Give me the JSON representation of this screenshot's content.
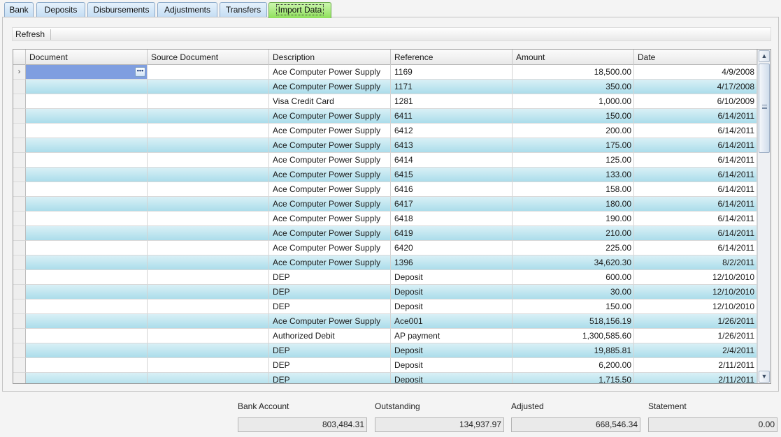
{
  "tabs": [
    {
      "label": "Bank",
      "active": false
    },
    {
      "label": "Deposits",
      "active": false
    },
    {
      "label": "Disbursements",
      "active": false
    },
    {
      "label": "Adjustments",
      "active": false
    },
    {
      "label": "Transfers",
      "active": false
    },
    {
      "label": "Import Data",
      "active": true
    }
  ],
  "toolbar": {
    "refresh_label": "Refresh"
  },
  "grid": {
    "columns": [
      "Document",
      "Source Document",
      "Description",
      "Reference",
      "Amount",
      "Date"
    ],
    "rows": [
      {
        "description": "Ace Computer Power  Supply",
        "reference": "1169",
        "amount": "18,500.00",
        "date": "4/9/2008"
      },
      {
        "description": "Ace Computer Power  Supply",
        "reference": "1171",
        "amount": "350.00",
        "date": "4/17/2008"
      },
      {
        "description": "Visa Credit Card",
        "reference": "1281",
        "amount": "1,000.00",
        "date": "6/10/2009"
      },
      {
        "description": "Ace Computer Power  Supply",
        "reference": "6411",
        "amount": "150.00",
        "date": "6/14/2011"
      },
      {
        "description": "Ace Computer Power  Supply",
        "reference": "6412",
        "amount": "200.00",
        "date": "6/14/2011"
      },
      {
        "description": "Ace Computer Power  Supply",
        "reference": "6413",
        "amount": "175.00",
        "date": "6/14/2011"
      },
      {
        "description": "Ace Computer Power  Supply",
        "reference": "6414",
        "amount": "125.00",
        "date": "6/14/2011"
      },
      {
        "description": "Ace Computer Power  Supply",
        "reference": "6415",
        "amount": "133.00",
        "date": "6/14/2011"
      },
      {
        "description": "Ace Computer Power  Supply",
        "reference": "6416",
        "amount": "158.00",
        "date": "6/14/2011"
      },
      {
        "description": "Ace Computer Power  Supply",
        "reference": "6417",
        "amount": "180.00",
        "date": "6/14/2011"
      },
      {
        "description": "Ace Computer Power  Supply",
        "reference": "6418",
        "amount": "190.00",
        "date": "6/14/2011"
      },
      {
        "description": "Ace Computer Power  Supply",
        "reference": "6419",
        "amount": "210.00",
        "date": "6/14/2011"
      },
      {
        "description": "Ace Computer Power  Supply",
        "reference": "6420",
        "amount": "225.00",
        "date": "6/14/2011"
      },
      {
        "description": "Ace Computer Power  Supply",
        "reference": "1396",
        "amount": "34,620.30",
        "date": "8/2/2011"
      },
      {
        "description": "DEP",
        "reference": "Deposit",
        "amount": "600.00",
        "date": "12/10/2010"
      },
      {
        "description": "DEP",
        "reference": "Deposit",
        "amount": "30.00",
        "date": "12/10/2010"
      },
      {
        "description": "DEP",
        "reference": "Deposit",
        "amount": "150.00",
        "date": "12/10/2010"
      },
      {
        "description": "Ace Computer Power Supply",
        "reference": "Ace001",
        "amount": "518,156.19",
        "date": "1/26/2011"
      },
      {
        "description": "Authorized Debit",
        "reference": "AP payment",
        "amount": "1,300,585.60",
        "date": "1/26/2011"
      },
      {
        "description": "DEP",
        "reference": "Deposit",
        "amount": "19,885.81",
        "date": "2/4/2011"
      },
      {
        "description": "DEP",
        "reference": "Deposit",
        "amount": "6,200.00",
        "date": "2/11/2011"
      },
      {
        "description": "DEP",
        "reference": "Deposit",
        "amount": "1,715.50",
        "date": "2/11/2011"
      }
    ]
  },
  "summary": {
    "bank_account": {
      "label": "Bank Account",
      "value": "803,484.31"
    },
    "outstanding": {
      "label": "Outstanding",
      "value": "134,937.97"
    },
    "adjusted": {
      "label": "Adjusted",
      "value": "668,546.34"
    },
    "statement": {
      "label": "Statement",
      "value": "0.00"
    }
  },
  "icons": {
    "row_indicator": "chevron-right-icon",
    "ellipsis": "ellipsis-icon",
    "scroll_up": "arrow-up-icon",
    "scroll_down": "arrow-down-icon"
  },
  "colors": {
    "active_tab": "#8ee05a",
    "tab": "#c3dcf3",
    "alt_row": "#a9dcea",
    "selected_cell": "#7f9ee0"
  }
}
